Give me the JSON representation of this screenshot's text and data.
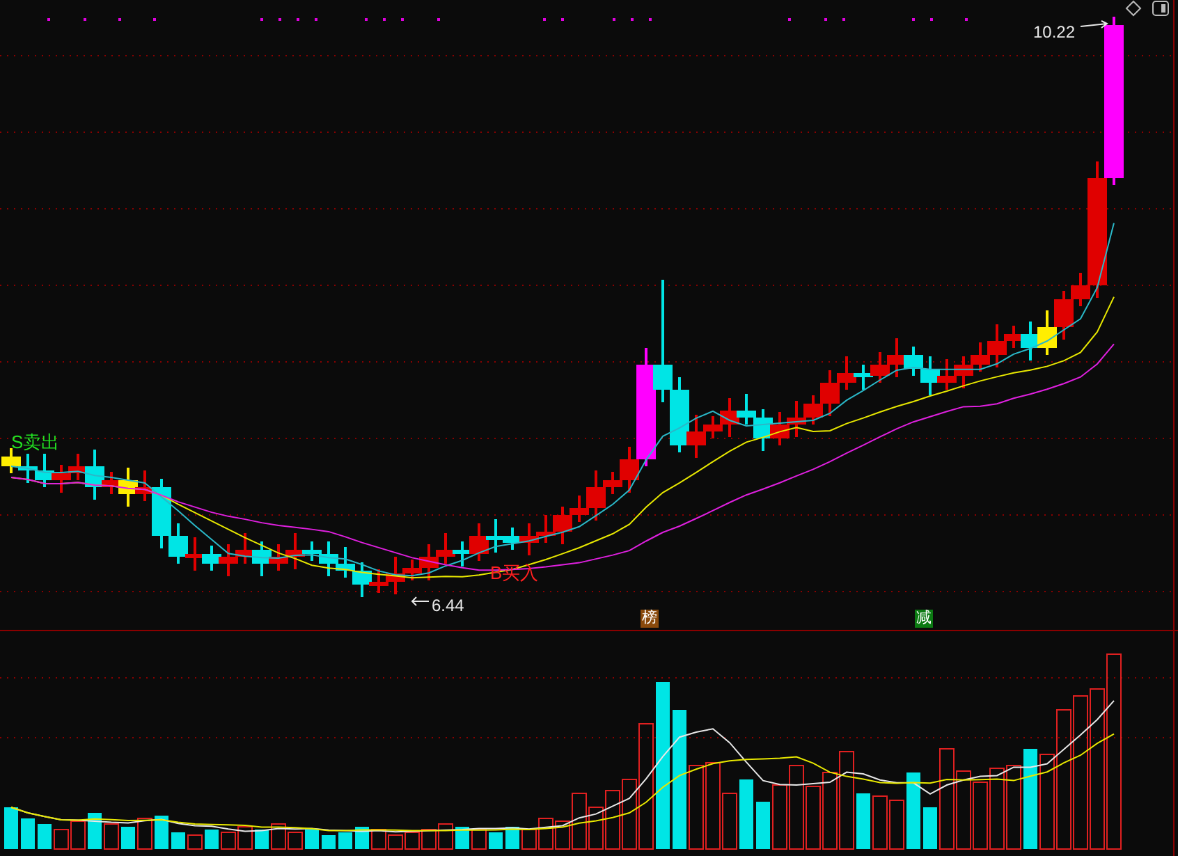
{
  "price_panel": {
    "high_label": "10.22",
    "low_label": "6.44",
    "signals": [
      {
        "kind": "sell",
        "text": "S卖出"
      },
      {
        "kind": "buy",
        "text": "B买入"
      }
    ],
    "badges": [
      {
        "text": "榜",
        "color": "#8a4a0c"
      },
      {
        "text": "减",
        "color": "#0b7a12"
      }
    ]
  }
}
